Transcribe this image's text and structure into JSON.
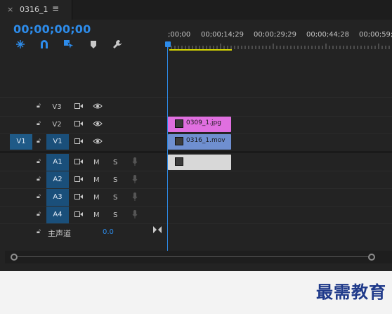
{
  "tab": {
    "close_glyph": "×",
    "title": "0316_1",
    "menu_glyph": "≡"
  },
  "timecode": "00;00;00;00",
  "toolbar": [
    "insert-nest-icon",
    "snap-icon",
    "linked-selection-icon",
    "add-marker-icon",
    "wrench-icon"
  ],
  "ruler": {
    "labels": [
      ";00;00",
      "00;00;14;29",
      "00;00;29;29",
      "00;00;44;28",
      "00;00;59;"
    ]
  },
  "video_tracks": [
    {
      "name": "V3",
      "source": "",
      "clip": ""
    },
    {
      "name": "V2",
      "source": "",
      "clip": "0309_1.jpg"
    },
    {
      "name": "V1",
      "source": "V1",
      "clip": "0316_1.mov"
    }
  ],
  "audio_tracks": [
    {
      "name": "A1",
      "m": "M",
      "s": "S"
    },
    {
      "name": "A2",
      "m": "M",
      "s": "S"
    },
    {
      "name": "A3",
      "m": "M",
      "s": "S"
    },
    {
      "name": "A4",
      "m": "M",
      "s": "S"
    }
  ],
  "master": {
    "label": "主声道",
    "value": "0.0"
  },
  "watermark": "最需教育",
  "colors": {
    "accent": "#2d8ceb",
    "image_clip": "#e06fe0",
    "video_clip": "#6f8fd0",
    "audio_clip": "#d8d8d8",
    "work_area": "#d7d700"
  }
}
